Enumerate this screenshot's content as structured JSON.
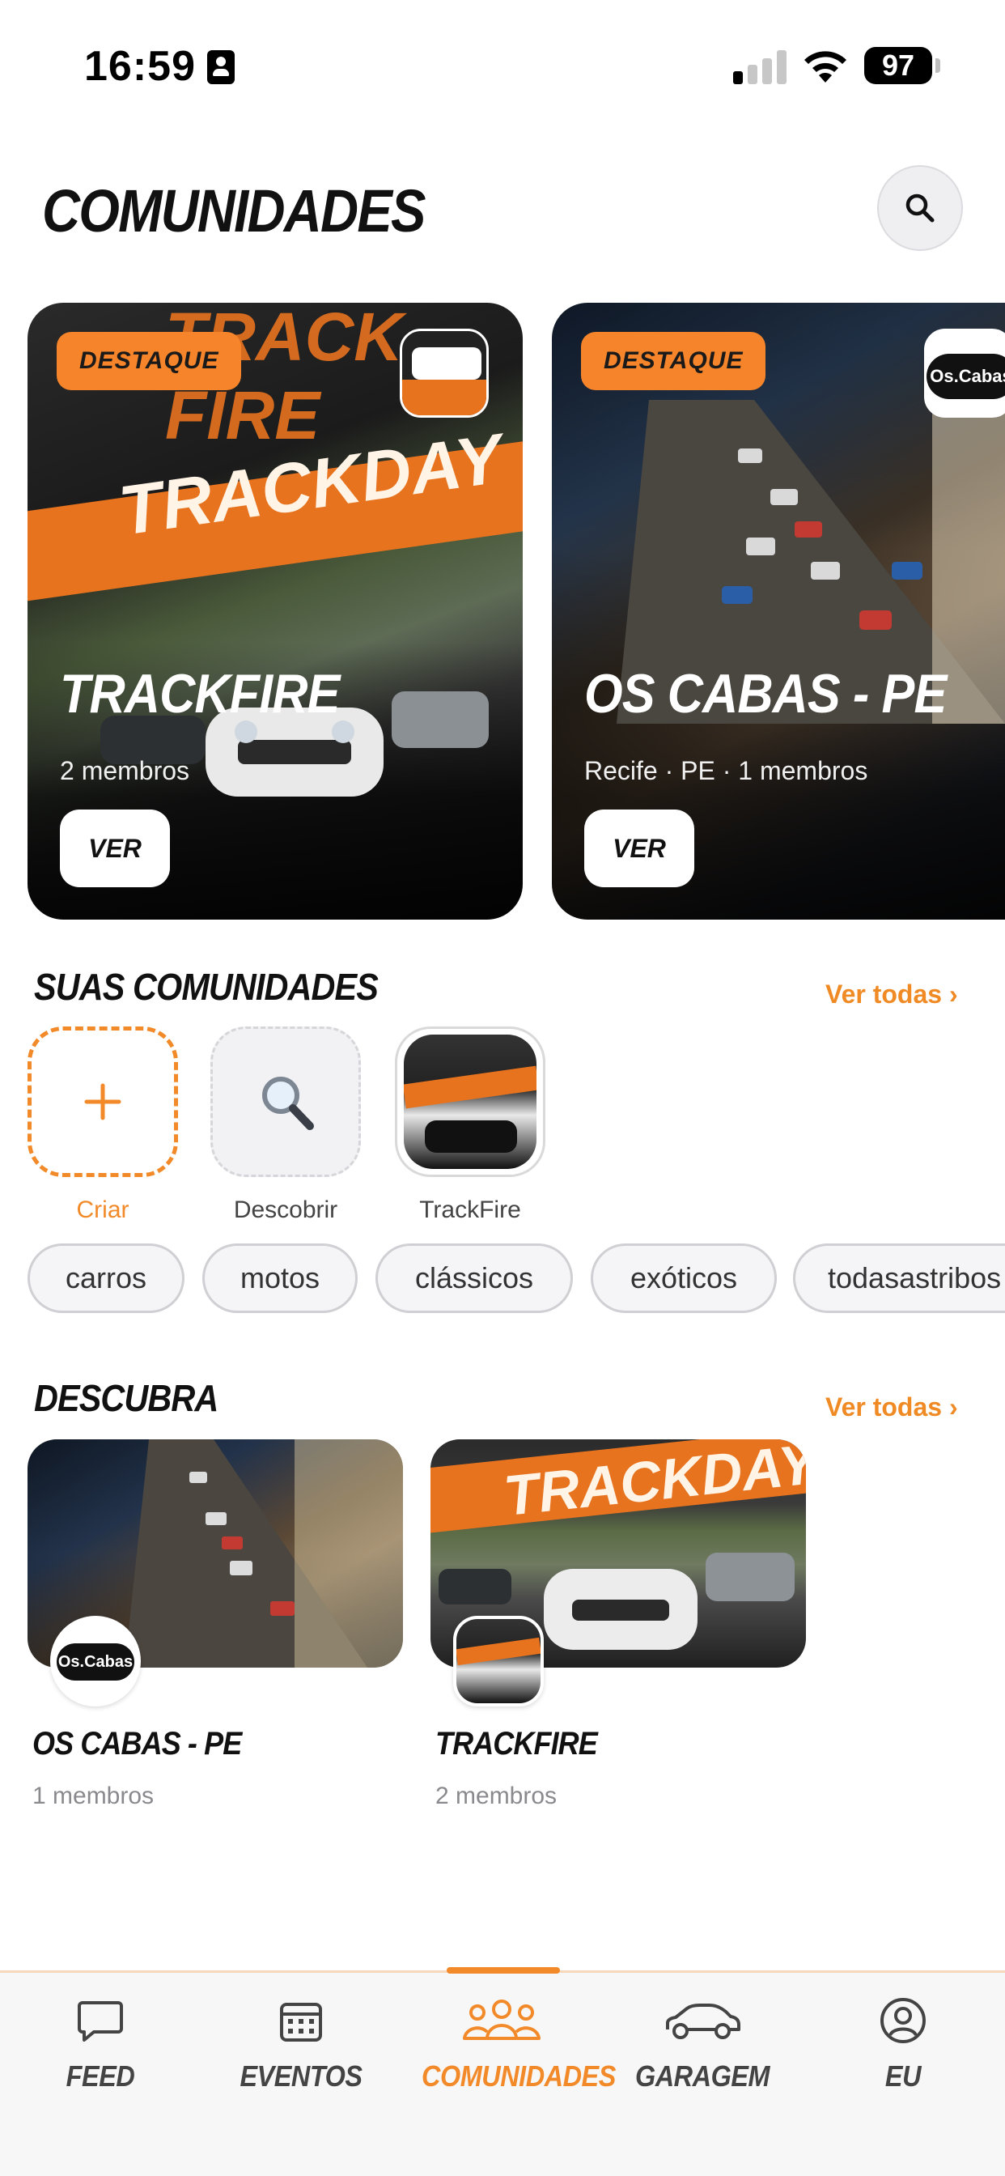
{
  "status_bar": {
    "time": "16:59",
    "battery": "97"
  },
  "header": {
    "title": "COMUNIDADES"
  },
  "featured": [
    {
      "badge": "DESTAQUE",
      "name": "TRACKFIRE",
      "meta": "2 membros",
      "button": "VER",
      "deco_title": "TRACKDAY",
      "deco_top": "TRACK FIRE"
    },
    {
      "badge": "DESTAQUE",
      "name": "OS CABAS - PE",
      "meta": "Recife · PE · 1 membros",
      "button": "VER",
      "logo_text": "Os.Cabas"
    }
  ],
  "my_communities": {
    "title": "SUAS COMUNIDADES",
    "see_all": "Ver todas",
    "tiles": [
      {
        "label": "Criar",
        "icon": "plus-icon"
      },
      {
        "label": "Descobrir",
        "icon": "magnifier-icon"
      },
      {
        "label": "TrackFire",
        "icon": "trackfire-logo"
      }
    ]
  },
  "chips": [
    "carros",
    "motos",
    "clássicos",
    "exóticos",
    "todasastribos"
  ],
  "discover": {
    "title": "DESCUBRA",
    "see_all": "Ver todas",
    "items": [
      {
        "name": "OS CABAS - PE",
        "meta": "1 membros",
        "logo_text": "Os.Cabas"
      },
      {
        "name": "TRACKFIRE",
        "meta": "2 membros",
        "deco_title": "TRACKDAY"
      }
    ]
  },
  "tabs": [
    {
      "label": "FEED",
      "icon": "chat-bubble-icon",
      "active": false
    },
    {
      "label": "EVENTOS",
      "icon": "calendar-icon",
      "active": false
    },
    {
      "label": "COMUNIDADES",
      "icon": "people-icon",
      "active": true
    },
    {
      "label": "GARAGEM",
      "icon": "car-icon",
      "active": false
    },
    {
      "label": "EU",
      "icon": "profile-icon",
      "active": false
    }
  ],
  "colors": {
    "accent": "#f28a2a",
    "badge": "#f5842a",
    "chip_border": "#cfcfd4"
  }
}
